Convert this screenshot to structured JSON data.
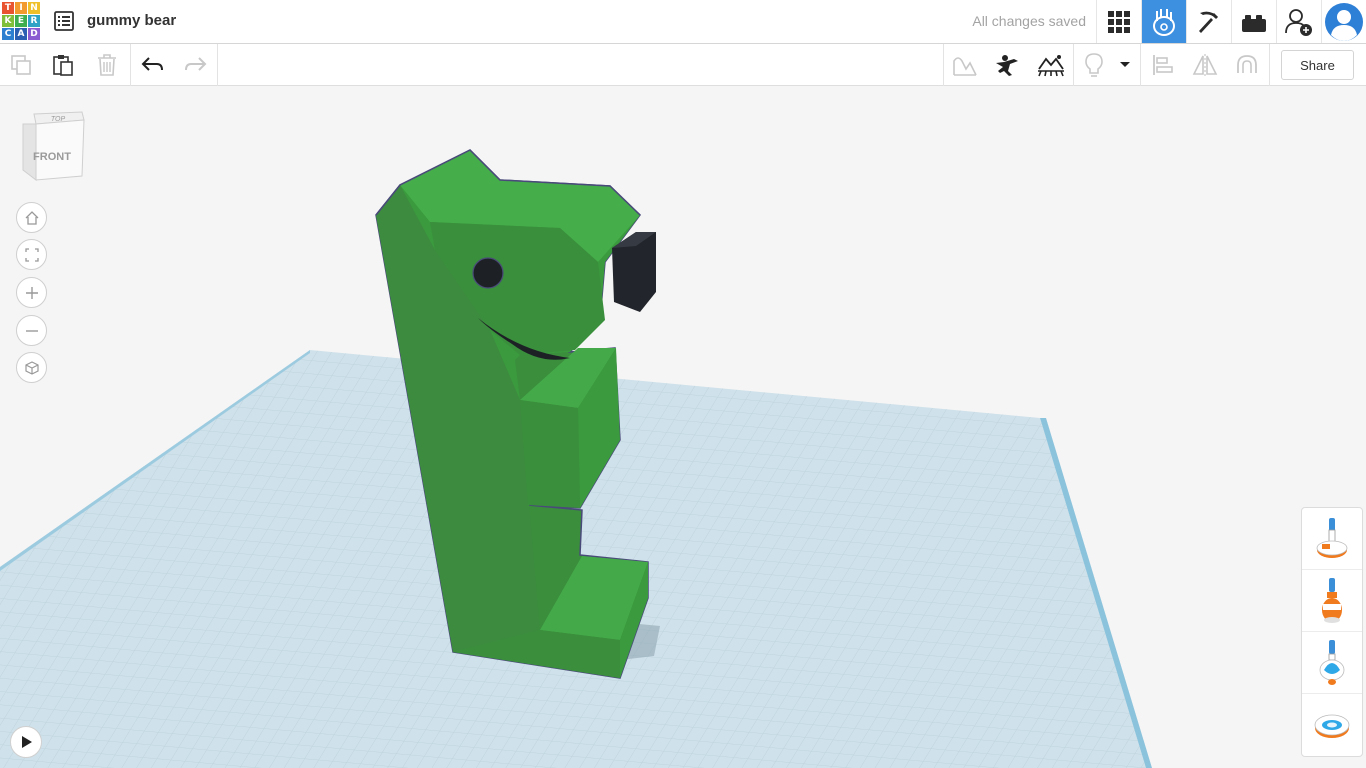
{
  "logo": {
    "letters": [
      "T",
      "I",
      "N",
      "K",
      "E",
      "R",
      "C",
      "A",
      "D"
    ],
    "colors": [
      "#e8542f",
      "#f29a2d",
      "#f0c02a",
      "#7fbf3a",
      "#3fae4f",
      "#2fa3c6",
      "#2d7fd0",
      "#2a5fb2",
      "#8b5bd1"
    ]
  },
  "header": {
    "design_title": "gummy bear",
    "save_status": "All changes saved"
  },
  "top_icons": [
    "grid-view-icon",
    "sim-lab-icon",
    "minecraft-pickaxe-icon",
    "lego-brick-icon",
    "invite-user-icon",
    "user-avatar-icon"
  ],
  "toolbar": {
    "share_label": "Share"
  },
  "viewcube": {
    "top_label": "TOP",
    "front_label": "FRONT"
  },
  "colors": {
    "accent": "#3d8fe0",
    "gummy_green": "#3b9a3f",
    "workplane": "#c9dde6"
  }
}
